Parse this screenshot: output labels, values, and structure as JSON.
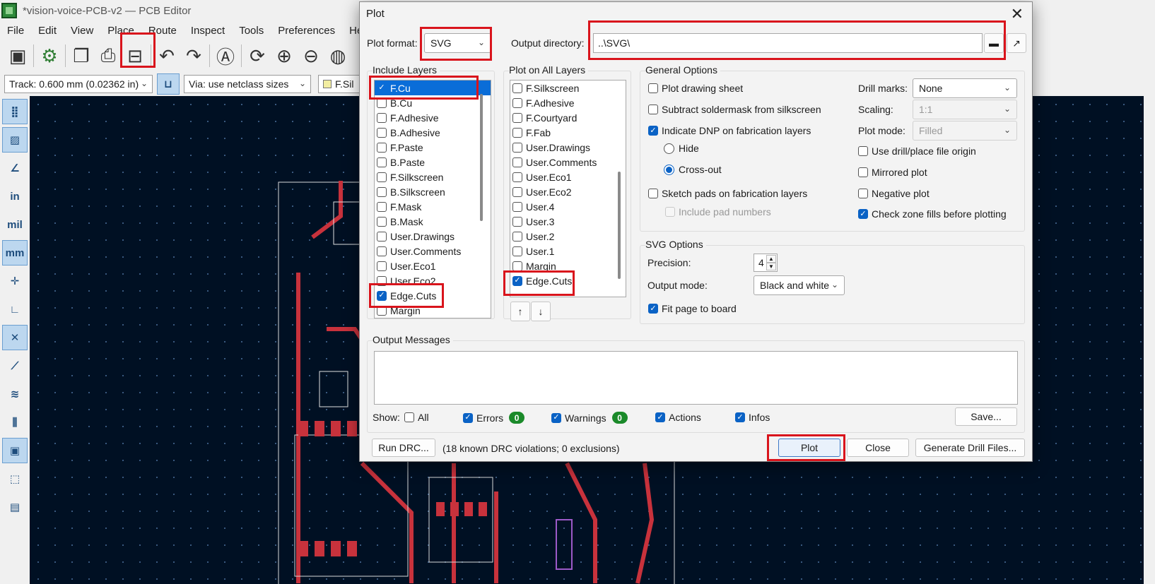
{
  "window": {
    "title": "*vision-voice-PCB-v2 — PCB Editor"
  },
  "menu": [
    "File",
    "Edit",
    "View",
    "Place",
    "Route",
    "Inspect",
    "Tools",
    "Preferences",
    "Help"
  ],
  "toolbar2": {
    "track": "Track: 0.600 mm (0.02362 in)",
    "via": "Via: use netclass sizes",
    "layer": "F.Sil"
  },
  "leftbar": {
    "in": "in",
    "mil": "mil",
    "mm": "mm"
  },
  "dialog": {
    "title": "Plot",
    "close": "✕",
    "plot_format_label": "Plot format:",
    "plot_format_value": "SVG",
    "output_dir_label": "Output directory:",
    "output_dir_value": "..\\SVG\\",
    "include_layers_title": "Include Layers",
    "include_layers": [
      {
        "label": "F.Cu",
        "checked": true
      },
      {
        "label": "B.Cu",
        "checked": false
      },
      {
        "label": "F.Adhesive",
        "checked": false
      },
      {
        "label": "B.Adhesive",
        "checked": false
      },
      {
        "label": "F.Paste",
        "checked": false
      },
      {
        "label": "B.Paste",
        "checked": false
      },
      {
        "label": "F.Silkscreen",
        "checked": false
      },
      {
        "label": "B.Silkscreen",
        "checked": false
      },
      {
        "label": "F.Mask",
        "checked": false
      },
      {
        "label": "B.Mask",
        "checked": false
      },
      {
        "label": "User.Drawings",
        "checked": false
      },
      {
        "label": "User.Comments",
        "checked": false
      },
      {
        "label": "User.Eco1",
        "checked": false
      },
      {
        "label": "User.Eco2",
        "checked": false
      },
      {
        "label": "Edge.Cuts",
        "checked": true
      },
      {
        "label": "Margin",
        "checked": false
      }
    ],
    "plot_all_title": "Plot on All Layers",
    "plot_all_layers": [
      {
        "label": "F.Silkscreen",
        "checked": false
      },
      {
        "label": "F.Adhesive",
        "checked": false
      },
      {
        "label": "F.Courtyard",
        "checked": false
      },
      {
        "label": "F.Fab",
        "checked": false
      },
      {
        "label": "User.Drawings",
        "checked": false
      },
      {
        "label": "User.Comments",
        "checked": false
      },
      {
        "label": "User.Eco1",
        "checked": false
      },
      {
        "label": "User.Eco2",
        "checked": false
      },
      {
        "label": "User.4",
        "checked": false
      },
      {
        "label": "User.3",
        "checked": false
      },
      {
        "label": "User.2",
        "checked": false
      },
      {
        "label": "User.1",
        "checked": false
      },
      {
        "label": "Margin",
        "checked": false
      },
      {
        "label": "Edge.Cuts",
        "checked": true
      }
    ],
    "move_up": "↑",
    "move_down": "↓",
    "general": {
      "title": "General Options",
      "plot_drawing_sheet": "Plot drawing sheet",
      "subtract_soldermask": "Subtract soldermask from silkscreen",
      "indicate_dnp": "Indicate DNP on fabrication layers",
      "hide": "Hide",
      "crossout": "Cross-out",
      "sketch_pads": "Sketch pads on fabrication layers",
      "include_pad_numbers": "Include pad numbers",
      "drill_marks_label": "Drill marks:",
      "drill_marks_value": "None",
      "scaling_label": "Scaling:",
      "scaling_value": "1:1",
      "plot_mode_label": "Plot mode:",
      "plot_mode_value": "Filled",
      "use_drill_origin": "Use drill/place file origin",
      "mirrored": "Mirrored plot",
      "negative": "Negative plot",
      "check_zone": "Check zone fills before plotting"
    },
    "svg": {
      "title": "SVG Options",
      "precision_label": "Precision:",
      "precision_value": "4",
      "output_mode_label": "Output mode:",
      "output_mode_value": "Black and white",
      "fit_page": "Fit page to board"
    },
    "messages": {
      "title": "Output Messages",
      "show_label": "Show:",
      "all": "All",
      "errors": "Errors",
      "errors_count": "0",
      "warnings": "Warnings",
      "warnings_count": "0",
      "actions": "Actions",
      "infos": "Infos",
      "save": "Save..."
    },
    "footer": {
      "run_drc": "Run DRC...",
      "drc_status": "(18 known DRC violations; 0 exclusions)",
      "plot": "Plot",
      "close": "Close",
      "generate_drill": "Generate Drill Files..."
    }
  },
  "colors": {
    "highlight": "#d9141c",
    "accent": "#0a62c5",
    "canvas": "#001023",
    "trace": "#c8323c"
  }
}
